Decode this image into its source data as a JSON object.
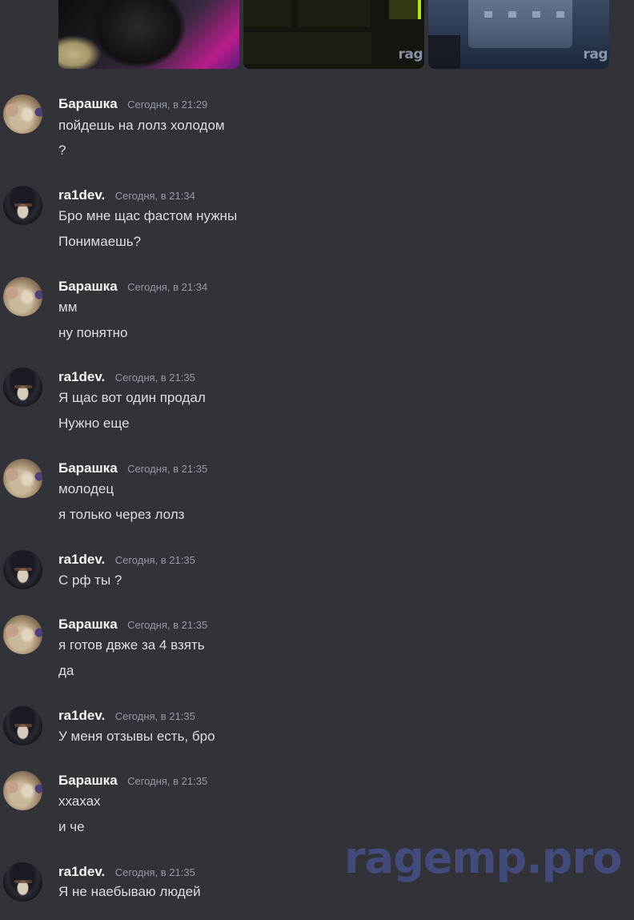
{
  "attachments": [
    {
      "name": "image-1",
      "watermark": ""
    },
    {
      "name": "image-2",
      "watermark": "rag"
    },
    {
      "name": "image-3",
      "watermark": "rag"
    }
  ],
  "messages": [
    {
      "author": "Барашка",
      "avatar": "barashka",
      "time": "Сегодня, в 21:29",
      "lines": [
        "пойдешь на лолз холодом",
        "?"
      ]
    },
    {
      "author": "ra1dev.",
      "avatar": "ra1dev",
      "time": "Сегодня, в 21:34",
      "lines": [
        "Бро мне щас фастом нужны",
        "Понимаешь?"
      ]
    },
    {
      "author": "Барашка",
      "avatar": "barashka",
      "time": "Сегодня, в 21:34",
      "lines": [
        "мм",
        "ну понятно"
      ]
    },
    {
      "author": "ra1dev.",
      "avatar": "ra1dev",
      "time": "Сегодня, в 21:35",
      "lines": [
        "Я щас вот один продал",
        "Нужно еще"
      ]
    },
    {
      "author": "Барашка",
      "avatar": "barashka",
      "time": "Сегодня, в 21:35",
      "lines": [
        "молодец",
        "я только через лолз"
      ]
    },
    {
      "author": "ra1dev.",
      "avatar": "ra1dev",
      "time": "Сегодня, в 21:35",
      "lines": [
        "С рф ты ?"
      ]
    },
    {
      "author": "Барашка",
      "avatar": "barashka",
      "time": "Сегодня, в 21:35",
      "lines": [
        "я готов двже за 4 взять",
        "да"
      ]
    },
    {
      "author": "ra1dev.",
      "avatar": "ra1dev",
      "time": "Сегодня, в 21:35",
      "lines": [
        "У меня отзывы есть, бро"
      ]
    },
    {
      "author": "Барашка",
      "avatar": "barashka",
      "time": "Сегодня, в 21:35",
      "lines": [
        "ххахах",
        "и че"
      ]
    },
    {
      "author": "ra1dev.",
      "avatar": "ra1dev",
      "time": "Сегодня, в 21:35",
      "lines": [
        "Я не наебываю людей"
      ]
    }
  ],
  "watermark": "ragemp.pro"
}
